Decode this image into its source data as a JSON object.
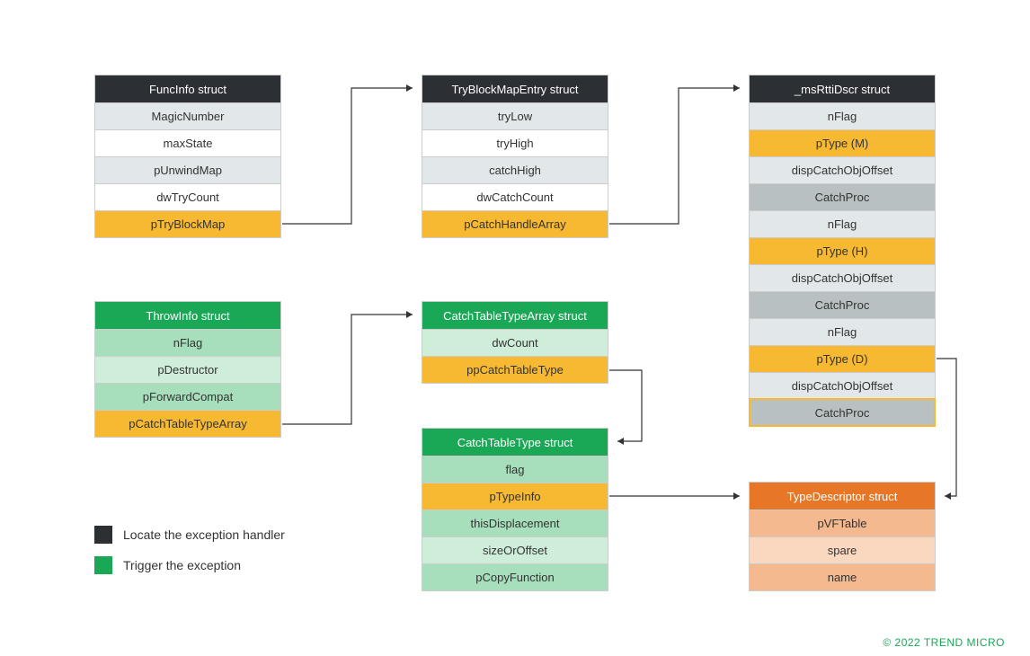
{
  "legend": {
    "locate": "Locate the exception handler",
    "trigger": "Trigger the exception"
  },
  "funcinfo": {
    "title": "FuncInfo struct",
    "magicNumber": "MagicNumber",
    "maxState": "maxState",
    "pUnwindMap": "pUnwindMap",
    "dwTryCount": "dwTryCount",
    "pTryBlockMap": "pTryBlockMap"
  },
  "tryblock": {
    "title": "TryBlockMapEntry struct",
    "tryLow": "tryLow",
    "tryHigh": "tryHigh",
    "catchHigh": "catchHigh",
    "dwCatchCount": "dwCatchCount",
    "pCatchHandleArray": "pCatchHandleArray"
  },
  "msrtti": {
    "title": "_msRttiDscr struct",
    "nFlag1": "nFlag",
    "pTypeM": "pType (M)",
    "disp1": "dispCatchObjOffset",
    "catchProc1": "CatchProc",
    "nFlag2": "nFlag",
    "pTypeH": "pType (H)",
    "disp2": "dispCatchObjOffset",
    "catchProc2": "CatchProc",
    "nFlag3": "nFlag",
    "pTypeD": "pType (D)",
    "disp3": "dispCatchObjOffset",
    "catchProc3": "CatchProc"
  },
  "throwinfo": {
    "title": "ThrowInfo struct",
    "nFlag": "nFlag",
    "pDestructor": "pDestructor",
    "pForwardCompat": "pForwardCompat",
    "pCatchTableTypeArray": "pCatchTableTypeArray"
  },
  "catcharray": {
    "title": "CatchTableTypeArray struct",
    "dwCount": "dwCount",
    "ppCatchTableType": "ppCatchTableType"
  },
  "catchtype": {
    "title": "CatchTableType struct",
    "flag": "flag",
    "pTypeInfo": "pTypeInfo",
    "thisDisplacement": "thisDisplacement",
    "sizeOrOffset": "sizeOrOffset",
    "pCopyFunction": "pCopyFunction"
  },
  "typedesc": {
    "title": "TypeDescriptor struct",
    "pVFTable": "pVFTable",
    "spare": "spare",
    "name": "name"
  },
  "copyright": "© 2022 TREND MICRO"
}
